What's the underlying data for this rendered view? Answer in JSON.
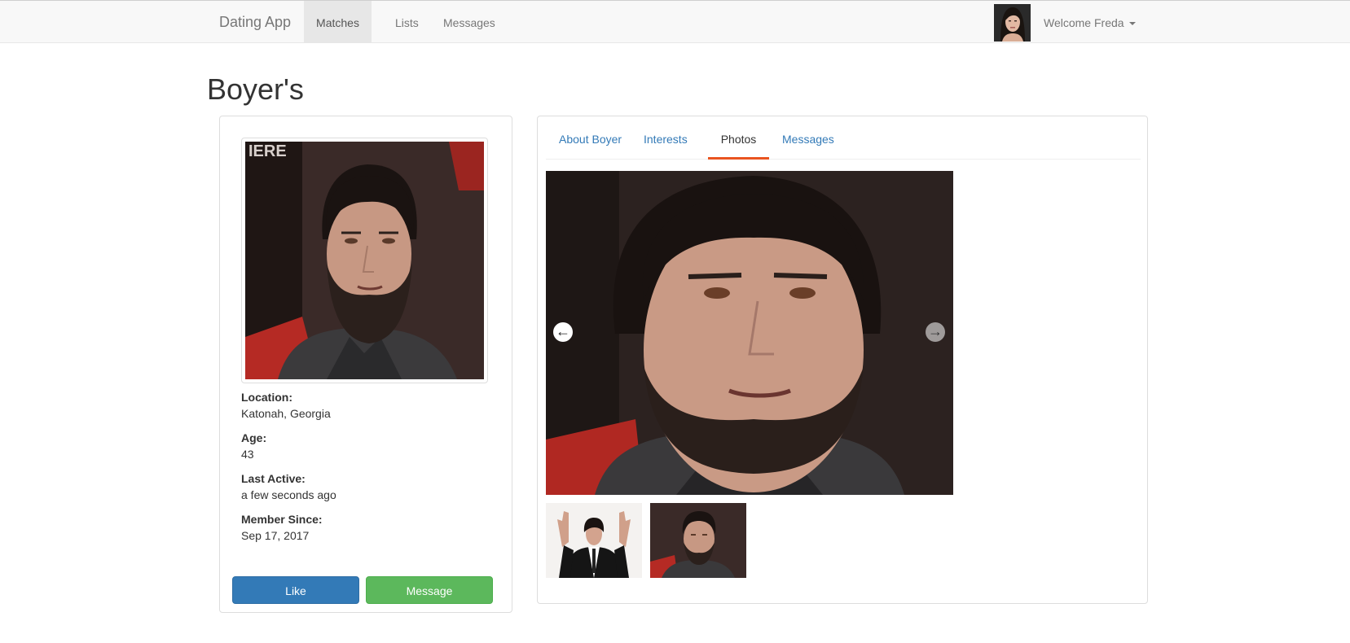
{
  "navbar": {
    "brand": "Dating App",
    "items": [
      {
        "label": "Matches",
        "active": true
      },
      {
        "label": "Lists",
        "active": false
      },
      {
        "label": "Messages",
        "active": false
      }
    ],
    "welcome": "Welcome Freda"
  },
  "page": {
    "title": "Boyer's"
  },
  "profile": {
    "location_label": "Location:",
    "location": "Katonah, Georgia",
    "age_label": "Age:",
    "age": "43",
    "last_active_label": "Last Active:",
    "last_active": "a few seconds ago",
    "member_since_label": "Member Since:",
    "member_since": "Sep 17, 2017",
    "like_button": "Like",
    "message_button": "Message"
  },
  "tabs": [
    {
      "label": "About Boyer",
      "active": false
    },
    {
      "label": "Interests",
      "active": false
    },
    {
      "label": "Photos",
      "active": true
    },
    {
      "label": "Messages",
      "active": false
    }
  ],
  "gallery": {
    "prev_icon": "arrow-left-circle",
    "next_icon": "arrow-right-circle",
    "thumbnails": [
      "man-in-suit-rock-gesture",
      "man-portrait-headshot"
    ]
  },
  "colors": {
    "primary": "#337ab7",
    "success": "#5cb85c",
    "tab_accent": "#e95420",
    "navbar_bg": "#f8f8f8"
  }
}
